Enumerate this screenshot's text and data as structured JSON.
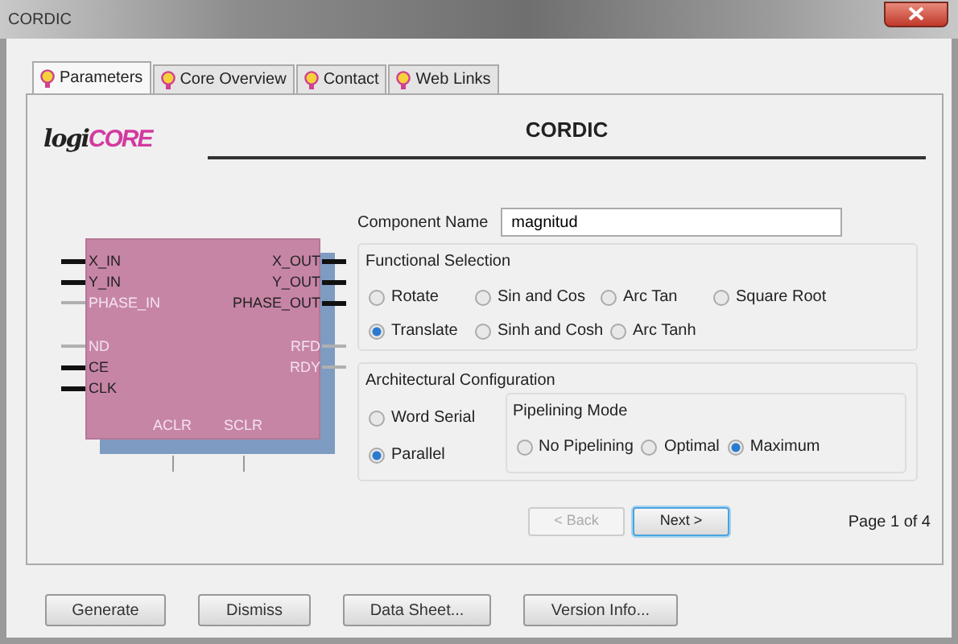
{
  "window": {
    "title": "CORDIC"
  },
  "tabs": [
    {
      "label": "Parameters",
      "selected": true
    },
    {
      "label": "Core Overview",
      "selected": false
    },
    {
      "label": "Contact",
      "selected": false
    },
    {
      "label": "Web Links",
      "selected": false
    }
  ],
  "logo": {
    "prefix": "logi",
    "suffix": "CORE"
  },
  "heading": "CORDIC",
  "symbol": {
    "left_pins": [
      {
        "label": "X_IN",
        "enabled": true
      },
      {
        "label": "Y_IN",
        "enabled": true
      },
      {
        "label": "PHASE_IN",
        "enabled": false
      },
      {
        "label": "ND",
        "enabled": false
      },
      {
        "label": "CE",
        "enabled": true
      },
      {
        "label": "CLK",
        "enabled": true
      }
    ],
    "right_pins": [
      {
        "label": "X_OUT",
        "enabled": true
      },
      {
        "label": "Y_OUT",
        "enabled": true
      },
      {
        "label": "PHASE_OUT",
        "enabled": true
      },
      {
        "label": "RFD",
        "enabled": false
      },
      {
        "label": "RDY",
        "enabled": false
      }
    ],
    "bottom_pins": [
      {
        "label": "ACLR",
        "enabled": false
      },
      {
        "label": "SCLR",
        "enabled": false
      }
    ]
  },
  "component_name": {
    "label": "Component Name",
    "value": "magnitud"
  },
  "functional_selection": {
    "title": "Functional Selection",
    "rows": [
      [
        {
          "label": "Rotate",
          "selected": false
        },
        {
          "label": "Sin and Cos",
          "selected": false
        },
        {
          "label": "Arc Tan",
          "selected": false
        },
        {
          "label": "Square Root",
          "selected": false
        }
      ],
      [
        {
          "label": "Translate",
          "selected": true
        },
        {
          "label": "Sinh and Cosh",
          "selected": false
        },
        {
          "label": "Arc Tanh",
          "selected": false
        }
      ]
    ]
  },
  "architectural_configuration": {
    "title": "Architectural Configuration",
    "options": [
      {
        "label": "Word Serial",
        "selected": false
      },
      {
        "label": "Parallel",
        "selected": true
      }
    ],
    "pipelining_mode": {
      "title": "Pipelining Mode",
      "options": [
        {
          "label": "No Pipelining",
          "selected": false
        },
        {
          "label": "Optimal",
          "selected": false
        },
        {
          "label": "Maximum",
          "selected": true
        }
      ]
    }
  },
  "navigation": {
    "back": {
      "label": "< Back",
      "disabled": true
    },
    "next": {
      "label": "Next >",
      "disabled": false
    },
    "page": "Page 1 of 4"
  },
  "buttons": [
    "Generate",
    "Dismiss",
    "Data Sheet...",
    "Version Info..."
  ]
}
